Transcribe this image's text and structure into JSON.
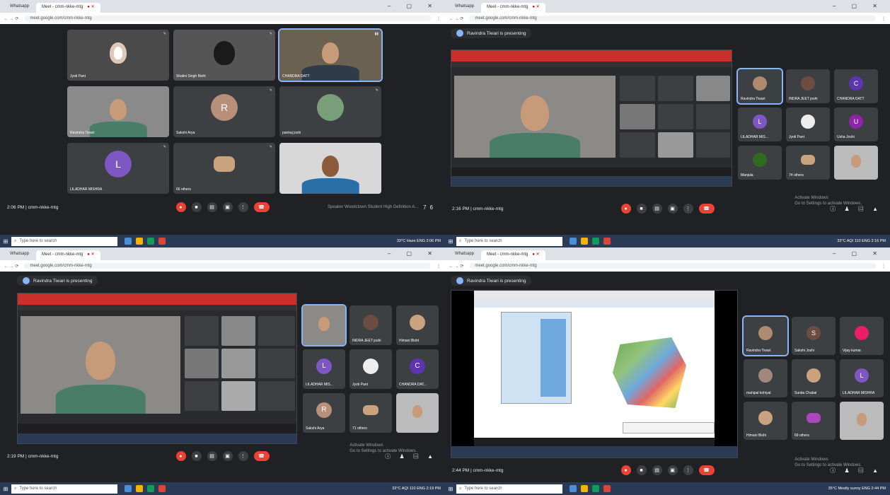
{
  "q1": {
    "tabs": [
      "Whatsapp",
      "Meet - cmm-nkke-mtg"
    ],
    "url": "meet.google.com/cmm-nkke-mtg",
    "participants": [
      {
        "name": "Jyoti Pant"
      },
      {
        "name": "Shalini Singh Bisht"
      },
      {
        "name": "CHANDRA DATT"
      },
      {
        "name": "Ravindra Tiwari"
      },
      {
        "name": "Sakshi Arya",
        "initial": "R"
      },
      {
        "name": "pankaj joshi"
      },
      {
        "name": "LILADHAR MISHRA",
        "initial": "L"
      },
      {
        "name": "66 others"
      },
      {
        "name": ""
      }
    ],
    "time": "2:06 PM | cmm-nkke-mtg",
    "caption": "Speaker Woodclown Student High Definition A...",
    "vol": "76",
    "search": "Type here to search",
    "tray": "33°C Haze  ENG 2:06 PM"
  },
  "q2": {
    "tabs": [
      "Whatsapp",
      "Meet - cmm-nkke-mtg"
    ],
    "url": "meet.google.com/cmm-nkke-mtg",
    "presenting": "Ravindra Tiwari is presenting",
    "participants": [
      {
        "name": "Ravindra Tiwari"
      },
      {
        "name": "INDRA JEET joshi"
      },
      {
        "name": "CHANDRA DATT",
        "initial": "C"
      },
      {
        "name": "LILADHAR MIS...",
        "initial": "L"
      },
      {
        "name": "Jyoti Pant"
      },
      {
        "name": "Usha Joshi",
        "initial": "U"
      },
      {
        "name": "Manjula"
      },
      {
        "name": "74 others"
      },
      {
        "name": ""
      }
    ],
    "time": "2:16 PM | cmm-nkke-mtg",
    "watermark": "Activate Windows\nGo to Settings to activate Windows.",
    "search": "Type here to search",
    "tray": "33°C AQI 110  ENG 2:16 PM"
  },
  "q3": {
    "tabs": [
      "Whatsapp",
      "Meet - cmm-nkke-mtg"
    ],
    "url": "meet.google.com/cmm-nkke-mtg",
    "presenting": "Ravindra Tiwari is presenting",
    "participants": [
      {
        "name": ""
      },
      {
        "name": "INDRA JEET joshi"
      },
      {
        "name": "Himani Bisht"
      },
      {
        "name": "LILADHAR MIS...",
        "initial": "L"
      },
      {
        "name": "Jyoti Pant"
      },
      {
        "name": "CHANDRA DAT...",
        "initial": "C"
      },
      {
        "name": "Sakshi Arya",
        "initial": "R"
      },
      {
        "name": "71 others"
      },
      {
        "name": ""
      }
    ],
    "time": "2:19 PM | cmm-nkke-mtg",
    "watermark": "Activate Windows\nGo to Settings to activate Windows.",
    "search": "Type here to search",
    "tray": "33°C AQI 110  ENG 2:19 PM"
  },
  "q4": {
    "tabs": [
      "Whatsapp",
      "Meet - cmm-nkke-mtg"
    ],
    "url": "meet.google.com/cmm-nkke-mtg",
    "presenting": "Ravindra Tiwari is presenting",
    "participants": [
      {
        "name": "Ravindra Tiwari"
      },
      {
        "name": "Sakshi Joshi",
        "initial": "S"
      },
      {
        "name": "Vijay kumar"
      },
      {
        "name": "mahipal kohiyal"
      },
      {
        "name": "Sunita Chabal"
      },
      {
        "name": "LILADHAR MISHRA",
        "initial": "L"
      },
      {
        "name": "Himani Bisht"
      },
      {
        "name": "69 others"
      },
      {
        "name": ""
      }
    ],
    "time": "2:44 PM | cmm-nkke-mtg",
    "watermark": "Activate Windows\nGo to Settings to activate Windows.",
    "search": "Type here to search",
    "tray": "35°C Mostly sunny  ENG 2:44 PM"
  }
}
